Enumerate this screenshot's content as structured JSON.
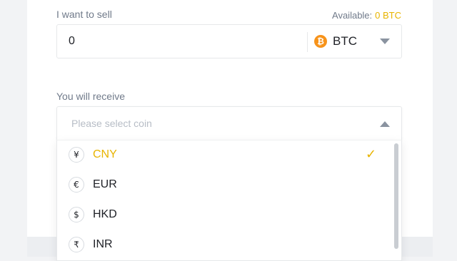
{
  "sell": {
    "label": "I want to sell",
    "available_label": "Available:",
    "available_amount": "0 BTC",
    "amount_value": "0",
    "coin": "BTC",
    "coin_icon": "₿"
  },
  "receive": {
    "label": "You will receive",
    "placeholder": "Please select coin"
  },
  "options": [
    {
      "symbol": "¥",
      "code": "CNY",
      "selected": true
    },
    {
      "symbol": "€",
      "code": "EUR",
      "selected": false
    },
    {
      "symbol": "$",
      "code": "HKD",
      "selected": false
    },
    {
      "symbol": "₹",
      "code": "INR",
      "selected": false
    }
  ],
  "colors": {
    "accent": "#e8b400",
    "btc": "#f7931a"
  },
  "icons": {
    "check": "✓"
  }
}
